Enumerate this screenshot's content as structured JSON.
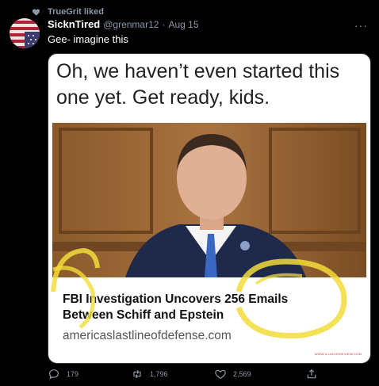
{
  "social_context": {
    "text": "TrueGrit liked",
    "icon": "heart-icon"
  },
  "author": {
    "display_name": "SicknTired",
    "handle": "@grenmar12",
    "separator": "·",
    "timestamp": "Aug 15",
    "avatar": "us-flag-avatar"
  },
  "more_menu": "···",
  "tweet_text": "Gee- imagine this",
  "media": {
    "headline_line1": "Oh, we haven’t even started this",
    "headline_line2": "one yet. Get ready, kids.",
    "caption_line1": "FBI Investigation Uncovers 256 Emails",
    "caption_line2": "Between Schiff and Epstein",
    "source": "americaslastlineofdefense.com",
    "watermark": "WWW.ILLINOISREVIEW.COM",
    "highlight_color": "#f2dc3a"
  },
  "actions": {
    "reply_count": "179",
    "retweet_count": "1,796",
    "like_count": "2,569",
    "reply_icon": "reply-icon",
    "retweet_icon": "retweet-icon",
    "like_icon": "heart-icon",
    "share_icon": "share-icon"
  },
  "colors": {
    "background": "#000000",
    "secondary_text": "#8b98a5",
    "primary_text": "#ffffff"
  }
}
